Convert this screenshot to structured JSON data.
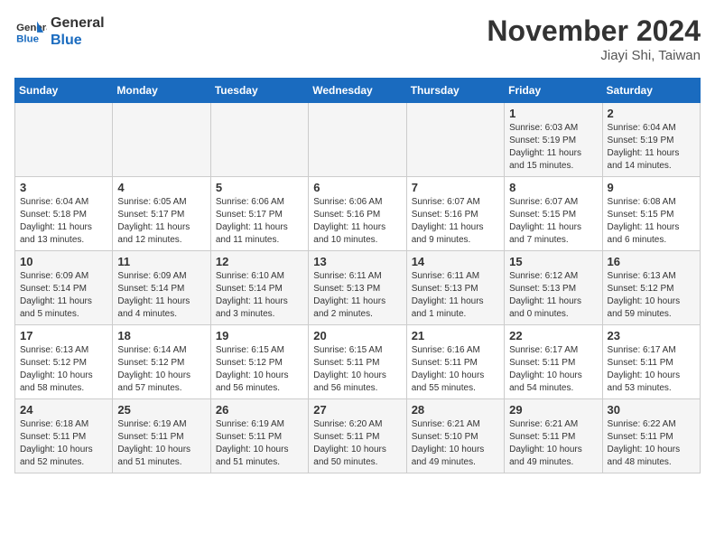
{
  "header": {
    "logo_line1": "General",
    "logo_line2": "Blue",
    "month_title": "November 2024",
    "subtitle": "Jiayi Shi, Taiwan"
  },
  "days_of_week": [
    "Sunday",
    "Monday",
    "Tuesday",
    "Wednesday",
    "Thursday",
    "Friday",
    "Saturday"
  ],
  "weeks": [
    [
      {
        "day": "",
        "info": ""
      },
      {
        "day": "",
        "info": ""
      },
      {
        "day": "",
        "info": ""
      },
      {
        "day": "",
        "info": ""
      },
      {
        "day": "",
        "info": ""
      },
      {
        "day": "1",
        "info": "Sunrise: 6:03 AM\nSunset: 5:19 PM\nDaylight: 11 hours and 15 minutes."
      },
      {
        "day": "2",
        "info": "Sunrise: 6:04 AM\nSunset: 5:19 PM\nDaylight: 11 hours and 14 minutes."
      }
    ],
    [
      {
        "day": "3",
        "info": "Sunrise: 6:04 AM\nSunset: 5:18 PM\nDaylight: 11 hours and 13 minutes."
      },
      {
        "day": "4",
        "info": "Sunrise: 6:05 AM\nSunset: 5:17 PM\nDaylight: 11 hours and 12 minutes."
      },
      {
        "day": "5",
        "info": "Sunrise: 6:06 AM\nSunset: 5:17 PM\nDaylight: 11 hours and 11 minutes."
      },
      {
        "day": "6",
        "info": "Sunrise: 6:06 AM\nSunset: 5:16 PM\nDaylight: 11 hours and 10 minutes."
      },
      {
        "day": "7",
        "info": "Sunrise: 6:07 AM\nSunset: 5:16 PM\nDaylight: 11 hours and 9 minutes."
      },
      {
        "day": "8",
        "info": "Sunrise: 6:07 AM\nSunset: 5:15 PM\nDaylight: 11 hours and 7 minutes."
      },
      {
        "day": "9",
        "info": "Sunrise: 6:08 AM\nSunset: 5:15 PM\nDaylight: 11 hours and 6 minutes."
      }
    ],
    [
      {
        "day": "10",
        "info": "Sunrise: 6:09 AM\nSunset: 5:14 PM\nDaylight: 11 hours and 5 minutes."
      },
      {
        "day": "11",
        "info": "Sunrise: 6:09 AM\nSunset: 5:14 PM\nDaylight: 11 hours and 4 minutes."
      },
      {
        "day": "12",
        "info": "Sunrise: 6:10 AM\nSunset: 5:14 PM\nDaylight: 11 hours and 3 minutes."
      },
      {
        "day": "13",
        "info": "Sunrise: 6:11 AM\nSunset: 5:13 PM\nDaylight: 11 hours and 2 minutes."
      },
      {
        "day": "14",
        "info": "Sunrise: 6:11 AM\nSunset: 5:13 PM\nDaylight: 11 hours and 1 minute."
      },
      {
        "day": "15",
        "info": "Sunrise: 6:12 AM\nSunset: 5:13 PM\nDaylight: 11 hours and 0 minutes."
      },
      {
        "day": "16",
        "info": "Sunrise: 6:13 AM\nSunset: 5:12 PM\nDaylight: 10 hours and 59 minutes."
      }
    ],
    [
      {
        "day": "17",
        "info": "Sunrise: 6:13 AM\nSunset: 5:12 PM\nDaylight: 10 hours and 58 minutes."
      },
      {
        "day": "18",
        "info": "Sunrise: 6:14 AM\nSunset: 5:12 PM\nDaylight: 10 hours and 57 minutes."
      },
      {
        "day": "19",
        "info": "Sunrise: 6:15 AM\nSunset: 5:12 PM\nDaylight: 10 hours and 56 minutes."
      },
      {
        "day": "20",
        "info": "Sunrise: 6:15 AM\nSunset: 5:11 PM\nDaylight: 10 hours and 56 minutes."
      },
      {
        "day": "21",
        "info": "Sunrise: 6:16 AM\nSunset: 5:11 PM\nDaylight: 10 hours and 55 minutes."
      },
      {
        "day": "22",
        "info": "Sunrise: 6:17 AM\nSunset: 5:11 PM\nDaylight: 10 hours and 54 minutes."
      },
      {
        "day": "23",
        "info": "Sunrise: 6:17 AM\nSunset: 5:11 PM\nDaylight: 10 hours and 53 minutes."
      }
    ],
    [
      {
        "day": "24",
        "info": "Sunrise: 6:18 AM\nSunset: 5:11 PM\nDaylight: 10 hours and 52 minutes."
      },
      {
        "day": "25",
        "info": "Sunrise: 6:19 AM\nSunset: 5:11 PM\nDaylight: 10 hours and 51 minutes."
      },
      {
        "day": "26",
        "info": "Sunrise: 6:19 AM\nSunset: 5:11 PM\nDaylight: 10 hours and 51 minutes."
      },
      {
        "day": "27",
        "info": "Sunrise: 6:20 AM\nSunset: 5:11 PM\nDaylight: 10 hours and 50 minutes."
      },
      {
        "day": "28",
        "info": "Sunrise: 6:21 AM\nSunset: 5:10 PM\nDaylight: 10 hours and 49 minutes."
      },
      {
        "day": "29",
        "info": "Sunrise: 6:21 AM\nSunset: 5:11 PM\nDaylight: 10 hours and 49 minutes."
      },
      {
        "day": "30",
        "info": "Sunrise: 6:22 AM\nSunset: 5:11 PM\nDaylight: 10 hours and 48 minutes."
      }
    ]
  ]
}
